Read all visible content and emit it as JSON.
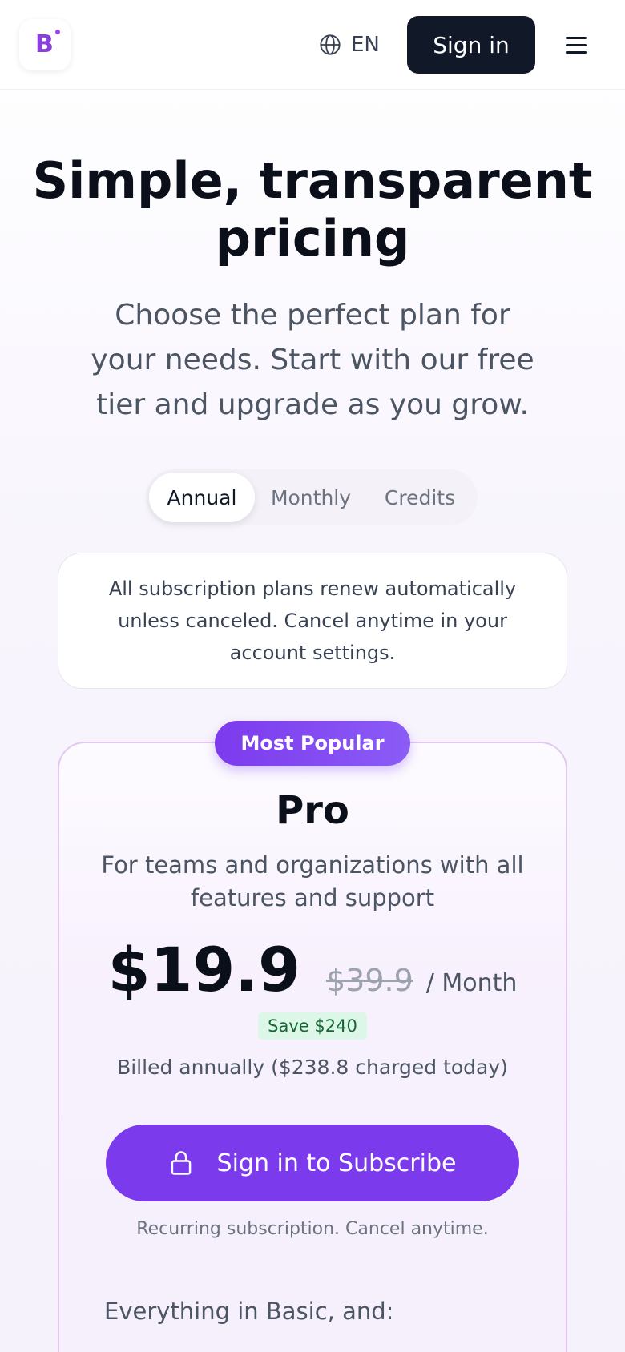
{
  "header": {
    "logo_letter": "B",
    "language": "EN",
    "signin_label": "Sign in",
    "icons": [
      "globe-icon",
      "hamburger-menu-icon"
    ]
  },
  "hero": {
    "title": "Simple, transparent pricing",
    "subtitle": "Choose the perfect plan for your needs. Start with our free tier and upgrade as you grow."
  },
  "billing_tabs": [
    {
      "label": "Annual",
      "active": true
    },
    {
      "label": "Monthly",
      "active": false
    },
    {
      "label": "Credits",
      "active": false
    }
  ],
  "notice": "All subscription plans renew automatically unless canceled. Cancel anytime in your account settings.",
  "plan": {
    "badge": "Most Popular",
    "name": "Pro",
    "description": "For teams and organizations with all features and support",
    "price": "$19.9",
    "original_price": "$39.9",
    "unit": "/ Month",
    "savings": "Save $240",
    "billing_note": "Billed annually ($238.8 charged today)",
    "cta_label": "Sign in to Subscribe",
    "cta_icon": "lock-icon",
    "recurring_note": "Recurring subscription. Cancel anytime.",
    "features_heading": "Everything in Basic, and:"
  },
  "colors": {
    "accent": "#7c3aed",
    "dark": "#111827",
    "savings_bg": "#dcf7e7",
    "savings_text": "#166534"
  }
}
